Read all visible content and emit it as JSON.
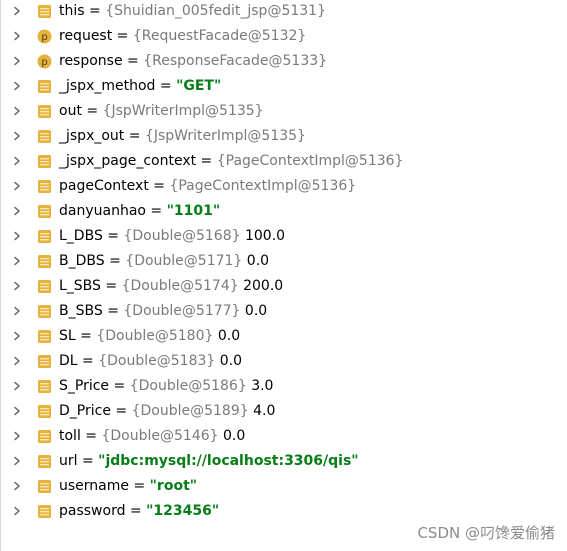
{
  "variables": [
    {
      "name": "this",
      "icon": "field-icon",
      "ref": "{Shuidian_005fedit_jsp@5131}",
      "value": "",
      "is_string": false
    },
    {
      "name": "request",
      "icon": "parameter-icon",
      "ref": "{RequestFacade@5132}",
      "value": "",
      "is_string": false
    },
    {
      "name": "response",
      "icon": "parameter-icon",
      "ref": "{ResponseFacade@5133}",
      "value": "",
      "is_string": false
    },
    {
      "name": "_jspx_method",
      "icon": "field-icon",
      "ref": "",
      "value": "\"GET\"",
      "is_string": true
    },
    {
      "name": "out",
      "icon": "field-icon",
      "ref": "{JspWriterImpl@5135}",
      "value": "",
      "is_string": false
    },
    {
      "name": "_jspx_out",
      "icon": "field-icon",
      "ref": "{JspWriterImpl@5135}",
      "value": "",
      "is_string": false
    },
    {
      "name": "_jspx_page_context",
      "icon": "field-icon",
      "ref": "{PageContextImpl@5136}",
      "value": "",
      "is_string": false
    },
    {
      "name": "pageContext",
      "icon": "field-icon",
      "ref": "{PageContextImpl@5136}",
      "value": "",
      "is_string": false
    },
    {
      "name": "danyuanhao",
      "icon": "field-icon",
      "ref": "",
      "value": "\"1101\"",
      "is_string": true
    },
    {
      "name": "L_DBS",
      "icon": "field-icon",
      "ref": "{Double@5168}",
      "value": "100.0",
      "is_string": false
    },
    {
      "name": "B_DBS",
      "icon": "field-icon",
      "ref": "{Double@5171}",
      "value": "0.0",
      "is_string": false
    },
    {
      "name": "L_SBS",
      "icon": "field-icon",
      "ref": "{Double@5174}",
      "value": "200.0",
      "is_string": false
    },
    {
      "name": "B_SBS",
      "icon": "field-icon",
      "ref": "{Double@5177}",
      "value": "0.0",
      "is_string": false
    },
    {
      "name": "SL",
      "icon": "field-icon",
      "ref": "{Double@5180}",
      "value": "0.0",
      "is_string": false
    },
    {
      "name": "DL",
      "icon": "field-icon",
      "ref": "{Double@5183}",
      "value": "0.0",
      "is_string": false
    },
    {
      "name": "S_Price",
      "icon": "field-icon",
      "ref": "{Double@5186}",
      "value": "3.0",
      "is_string": false
    },
    {
      "name": "D_Price",
      "icon": "field-icon",
      "ref": "{Double@5189}",
      "value": "4.0",
      "is_string": false
    },
    {
      "name": "toll",
      "icon": "field-icon",
      "ref": "{Double@5146}",
      "value": "0.0",
      "is_string": false
    },
    {
      "name": "url",
      "icon": "field-icon",
      "ref": "",
      "value": "\"jdbc:mysql://localhost:3306/qis\"",
      "is_string": true
    },
    {
      "name": "username",
      "icon": "field-icon",
      "ref": "",
      "value": "\"root\"",
      "is_string": true
    },
    {
      "name": "password",
      "icon": "field-icon",
      "ref": "",
      "value": "\"123456\"",
      "is_string": true
    }
  ],
  "equals_sign": " = ",
  "parameter_letter": "p",
  "watermark": "CSDN @叼馋爱偷猪",
  "colors": {
    "field_icon": "#e6b23e",
    "parameter_icon": "#e6b23e",
    "string_value": "#067d17",
    "reference": "#7a7a7a",
    "chevron": "#6e6e6e"
  }
}
